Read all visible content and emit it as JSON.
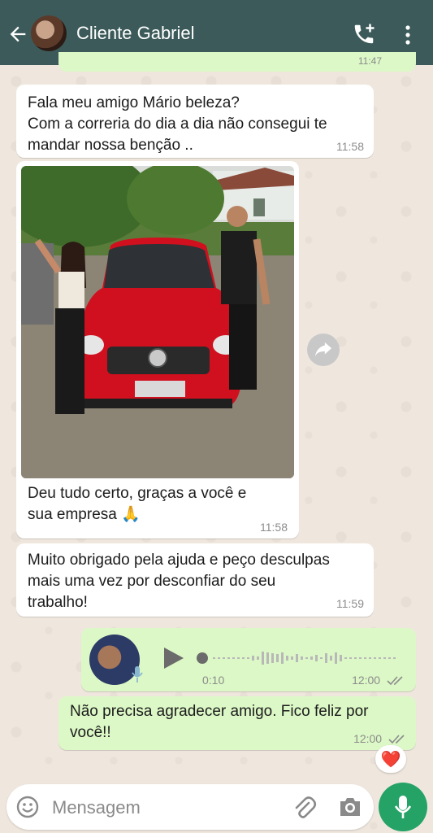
{
  "header": {
    "contact_name": "Cliente Gabriel"
  },
  "previous_bubble": {
    "time": "11:47"
  },
  "messages": [
    {
      "text": "Fala meu amigo Mário beleza?\nCom a correria do dia a dia não consegui te\nmandar nossa benção ..",
      "time": "11:58"
    },
    {
      "caption": "Deu tudo certo, graças a você e\nsua empresa 🙏",
      "time": "11:58"
    },
    {
      "text": "Muito obrigado pela ajuda e peço desculpas\nmais uma vez por desconfiar do seu\ntrabalho!",
      "time": "11:59"
    },
    {
      "duration": "0:10",
      "time": "12:00"
    },
    {
      "text": "Não precisa agradecer amigo. Fico feliz por\nvocê!!",
      "time": "12:00"
    }
  ],
  "reaction": {
    "emoji": "❤️"
  },
  "composer": {
    "placeholder": "Mensagem"
  },
  "colors": {
    "header": "#3c5a5a",
    "outgoing": "#dcf8c6",
    "incoming": "#ffffff",
    "mic": "#25a366"
  },
  "icons": [
    "back-arrow-icon",
    "add-call-icon",
    "more-vert-icon",
    "forward-icon",
    "play-icon",
    "mic-icon",
    "emoji-icon",
    "attach-icon",
    "camera-icon",
    "read-ticks-icon"
  ]
}
